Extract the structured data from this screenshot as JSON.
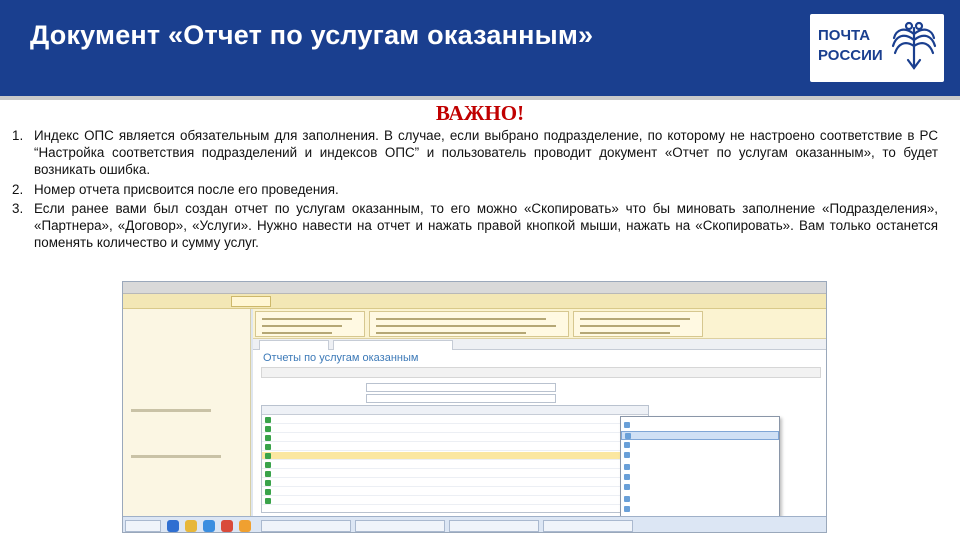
{
  "slide": {
    "title": "Документ «Отчет по услугам оказанным»",
    "logo_text_line1": "ПОЧТА",
    "logo_text_line2": "РОССИИ",
    "important_label": "ВАЖНО!"
  },
  "notes": [
    {
      "num": "1.",
      "text": "Индекс ОПС является обязательным для заполнения. В случае, если выбрано подразделение, по которому не настроено соответствие в РС “Настройка соответствия подразделений и индексов ОПС” и пользователь проводит документ «Отчет по услугам оказанным», то будет возникать ошибка."
    },
    {
      "num": "2.",
      "text": "Номер отчета присвоится после его проведения."
    },
    {
      "num": "3.",
      "text": "Если ранее вами был создан отчет по услугам оказанным, то его можно «Скопировать» что бы миновать заполнение «Подразделения», «Партнера», «Договор», «Услуги». Нужно навести на отчет и нажать правой кнопкой мыши, нажать на «Скопировать». Вам только останется поменять количество и сумму услуг."
    }
  ],
  "screenshot": {
    "doc_title": "Отчеты по услугам оказанным",
    "colors": {
      "header_blue": "#1a3f8f",
      "important_red": "#c00000",
      "menu_highlight": "#cfe0f5",
      "selected_row": "#fbe7a1"
    },
    "context_menu_icon": "copy-icon"
  }
}
